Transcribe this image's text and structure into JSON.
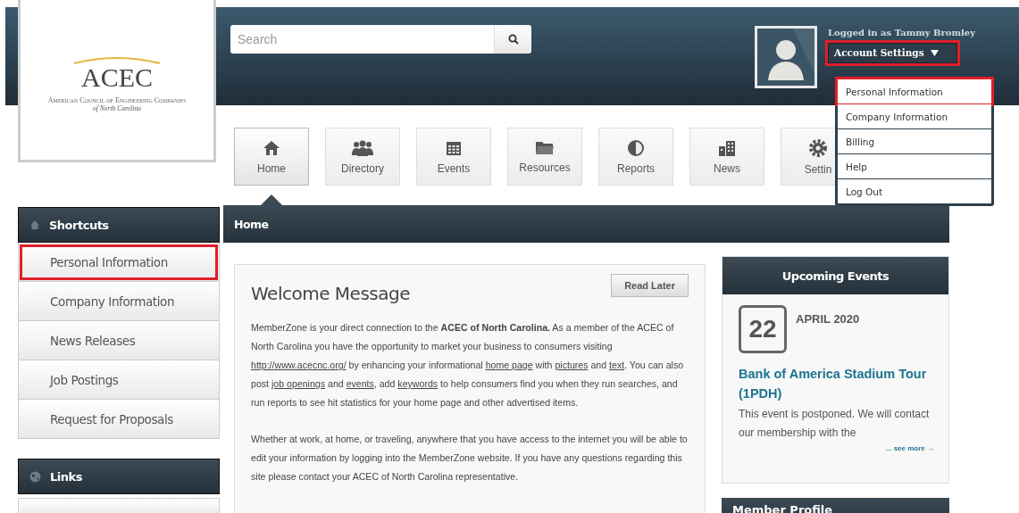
{
  "logo": {
    "title": "ACEC",
    "subtitle": "American Council of Engineering Companies",
    "region": "of North Carolina"
  },
  "header": {
    "search": {
      "placeholder": "Search"
    },
    "logged_in": "Logged in as Tammy Bromley",
    "account_button": {
      "label": "Account Settings",
      "highlighted": true
    },
    "menu": {
      "expanded": true,
      "items": [
        {
          "label": "Personal Information",
          "highlighted": true
        },
        {
          "label": "Company Information",
          "highlighted": false
        },
        {
          "label": "Billing",
          "highlighted": false
        },
        {
          "label": "Help",
          "highlighted": false
        },
        {
          "label": "Log Out",
          "highlighted": false
        }
      ]
    }
  },
  "nav": [
    {
      "label": "Home",
      "selected": true
    },
    {
      "label": "Directory",
      "selected": false
    },
    {
      "label": "Events",
      "selected": false
    },
    {
      "label": "Resources",
      "selected": false
    },
    {
      "label": "Reports",
      "selected": false
    },
    {
      "label": "News",
      "selected": false
    },
    {
      "label": "Settin",
      "selected": false
    }
  ],
  "breadcrumb": "Home",
  "sidebar": {
    "shortcuts": {
      "title": "Shortcuts",
      "items": [
        {
          "label": "Personal Information",
          "highlighted": true
        },
        {
          "label": "Company Information",
          "highlighted": false
        },
        {
          "label": "News Releases",
          "highlighted": false
        },
        {
          "label": "Job Postings",
          "highlighted": false
        },
        {
          "label": "Request for Proposals",
          "highlighted": false
        }
      ]
    },
    "links": {
      "title": "Links"
    }
  },
  "welcome": {
    "title": "Welcome Message",
    "button": "Read Later",
    "paragraphs": [
      [
        {
          "kind": "plain",
          "text": "MemberZone is your direct connection to the "
        },
        {
          "kind": "bold",
          "text": "ACEC of North Carolina."
        },
        {
          "kind": "plain",
          "text": "  As a member of the ACEC of North Carolina you have the opportunity to market your business to consumers visiting "
        },
        {
          "kind": "link",
          "text": "http://www.acecnc.org/"
        },
        {
          "kind": "plain",
          "text": " by enhancing your informational "
        },
        {
          "kind": "link",
          "text": "home page"
        },
        {
          "kind": "plain",
          "text": " with "
        },
        {
          "kind": "link",
          "text": "pictures"
        },
        {
          "kind": "plain",
          "text": " and "
        },
        {
          "kind": "link",
          "text": "text"
        },
        {
          "kind": "plain",
          "text": ".  You can also post "
        },
        {
          "kind": "link",
          "text": "job openings"
        },
        {
          "kind": "plain",
          "text": " and "
        },
        {
          "kind": "link",
          "text": "events"
        },
        {
          "kind": "plain",
          "text": ", add "
        },
        {
          "kind": "link",
          "text": "keywords"
        },
        {
          "kind": "plain",
          "text": " to help consumers find you when they run searches, and run reports to see hit statistics for your home page and other advertised items."
        }
      ],
      [
        {
          "kind": "plain",
          "text": "Whether at work, at home, or traveling, anywhere that you have access to the internet you will be able to edit your information by logging into the MemberZone website.  If you have any questions regarding this site please contact your ACEC of North Carolina representative."
        }
      ]
    ]
  },
  "events": {
    "title": "Upcoming Events",
    "day": "22",
    "month": "APRIL 2020",
    "event_title": "Bank of America Stadium Tour (1PDH)",
    "description": "This event is postponed.  We will contact our membership with the",
    "more": "... see more →"
  },
  "member_profile": {
    "title": "Member Profile"
  }
}
